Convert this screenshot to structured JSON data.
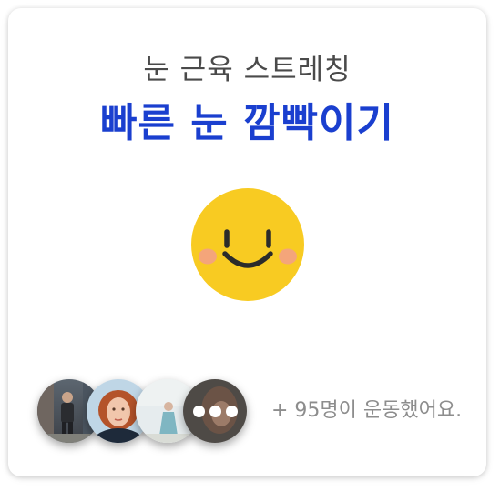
{
  "header": {
    "subtitle": "눈 근육 스트레칭",
    "title": "빠른 눈 깜빡이기"
  },
  "illustration": {
    "icon": "smiley-face-icon",
    "face_color": "#f8cb22",
    "cheek_color": "#f4a57a",
    "feature_color": "#2b2b2b"
  },
  "participants": {
    "more_icon": "more-dots-icon",
    "count_text": "+ 95명이 운동했어요."
  },
  "colors": {
    "title": "#1a3fcf",
    "subtitle": "#4a4a4a",
    "count": "#8d8d8d"
  }
}
